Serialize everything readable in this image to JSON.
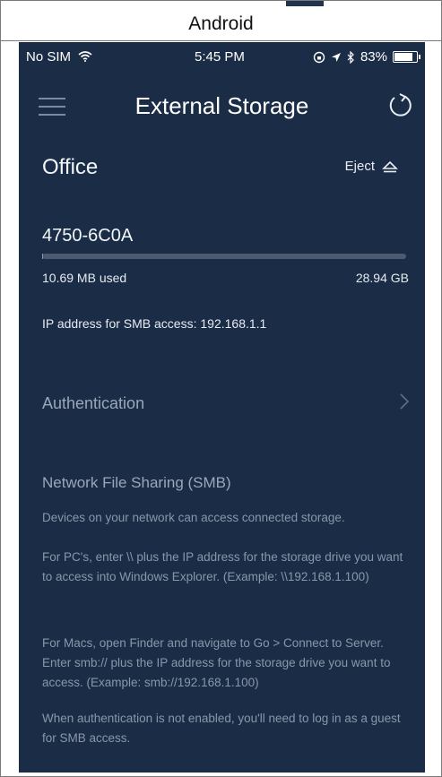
{
  "caption": "Android",
  "status_bar": {
    "carrier": "No SIM",
    "time": "5:45 PM",
    "battery": "83%",
    "battery_level": 0.83,
    "icons": [
      "wifi-icon",
      "lock-rotation-icon",
      "location-icon",
      "bluetooth-icon",
      "battery-icon"
    ]
  },
  "header": {
    "title": "External Storage",
    "menu_icon": "hamburger-icon",
    "refresh_icon": "refresh-icon"
  },
  "storage": {
    "location": "Office",
    "eject_label": "Eject",
    "device_name": "4750-6C0A",
    "used_label": "10.69 MB used",
    "total_label": "28.94 GB",
    "used_fraction": 0.0004,
    "ip_text": "IP address for SMB access: 192.168.1.1"
  },
  "authentication": {
    "label": "Authentication"
  },
  "smb": {
    "title": "Network File Sharing (SMB)",
    "paragraphs": [
      "Devices on your network can access connected storage.",
      "For PC's, enter \\\\ plus the IP address for the storage drive you want to access into Windows Explorer. (Example: \\\\192.168.1.100)",
      "For Macs, open Finder and navigate to Go > Connect to Server. Enter smb:// plus the IP address for the storage drive you want to access. (Example: smb://192.168.1.100)",
      "When authentication is not enabled, you'll need to log in as a guest for SMB access."
    ]
  },
  "colors": {
    "background": "#1b2d46",
    "text_primary": "#f3f6fa",
    "text_muted": "#8896aa"
  }
}
